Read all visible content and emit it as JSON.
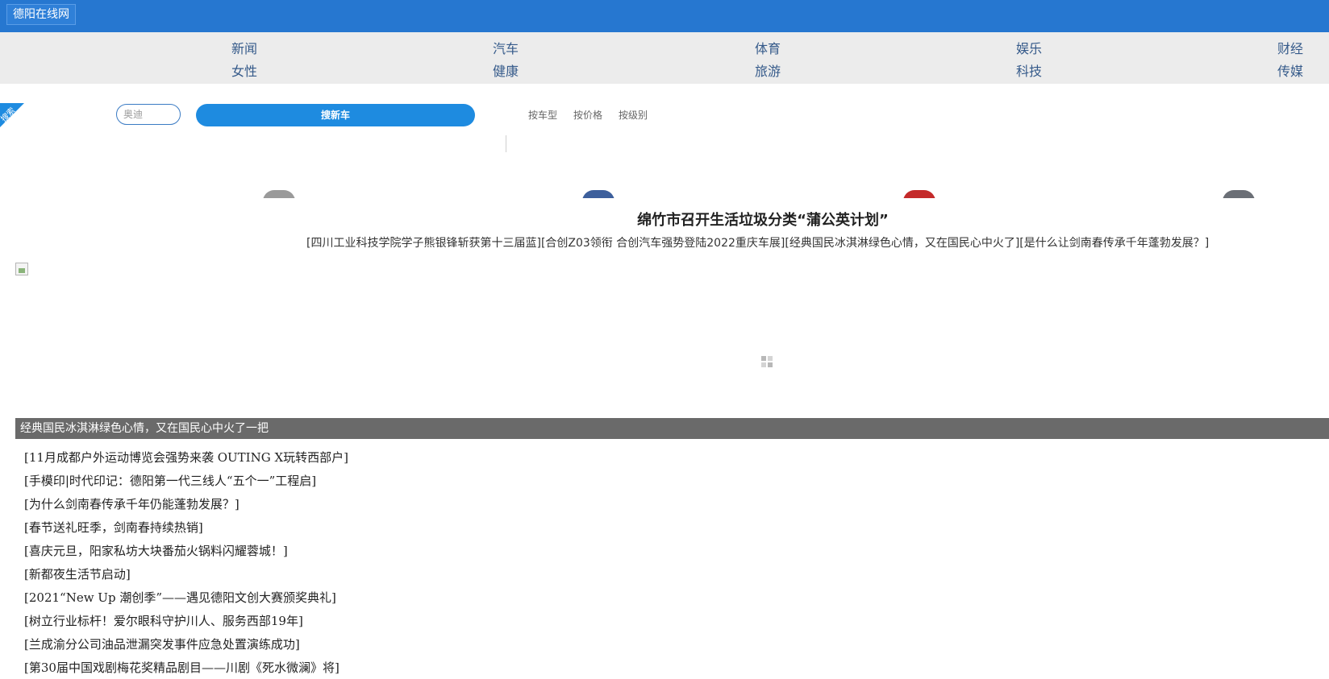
{
  "header": {
    "site_name": "德阳在线网",
    "brand_color": "#2677d0"
  },
  "nav": {
    "row1": [
      "新闻",
      "汽车",
      "体育",
      "娱乐",
      "财经"
    ],
    "row2": [
      "女性",
      "健康",
      "旅游",
      "科技",
      "传媒"
    ]
  },
  "car_search": {
    "corner_label": "搜索",
    "input_placeholder": "奥迪",
    "button_label": "搜新车",
    "filters": [
      "按车型",
      "按价格",
      "按级别"
    ],
    "accent_color": "#1e8be0"
  },
  "car_thumbnails": [
    {
      "icon": "silver-car-icon",
      "color": "#9a9a9a"
    },
    {
      "icon": "blue-car-icon",
      "color": "#3d5f9c"
    },
    {
      "icon": "red-car-icon",
      "color": "#c42a2a"
    },
    {
      "icon": "grey-car-icon",
      "color": "#6b6f76"
    }
  ],
  "headline": {
    "title": "绵竹市召开生活垃圾分类“蒲公英计划”",
    "links": [
      "[四川工业科技学院学子熊银锋斩获第十三届蓝]",
      "[合创Z03领衔 合创汽车强势登陆2022重庆车展]",
      "[经典国民冰淇淋绿色心情，又在国民心中火了]",
      "[是什么让剑南春传承千年蓬勃发展？]"
    ]
  },
  "slideshow": {
    "caption": "经典国民冰淇淋绿色心情，又在国民心中火了一把"
  },
  "news_list": [
    "[11月成都户外运动博览会强势来袭 OUTING X玩转西部户]",
    "[手模印|时代印记：德阳第一代三线人“五个一”工程启]",
    "[为什么剑南春传承千年仍能蓬勃发展？]",
    "[春节送礼旺季，剑南春持续热销]",
    "[喜庆元旦，阳家私坊大块番茄火锅料闪耀蓉城！]",
    "[新都夜生活节启动]",
    "[2021“New Up 潮创季”——遇见德阳文创大赛颁奖典礼]",
    "[树立行业标杆！爱尔眼科守护川人、服务西部19年]",
    "[兰成渝分公司油品泄漏突发事件应急处置演练成功]",
    "[第30届中国戏剧梅花奖精品剧目——川剧《死水微澜》将]"
  ]
}
